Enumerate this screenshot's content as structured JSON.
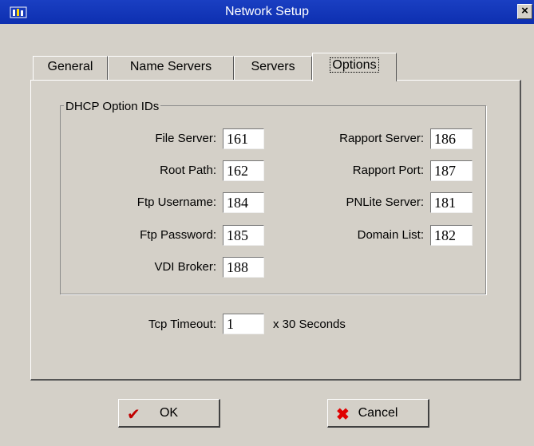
{
  "window": {
    "title": "Network Setup",
    "close_glyph": "×"
  },
  "tabs": [
    {
      "label": "General"
    },
    {
      "label": "Name Servers"
    },
    {
      "label": "Servers"
    },
    {
      "label": "Options",
      "active": true
    }
  ],
  "group": {
    "label": "DHCP Option IDs"
  },
  "left_fields": [
    {
      "label": "File Server:",
      "value": "161"
    },
    {
      "label": "Root Path:",
      "value": "162"
    },
    {
      "label": "Ftp Username:",
      "value": "184"
    },
    {
      "label": "Ftp Password:",
      "value": "185"
    },
    {
      "label": "VDI Broker:",
      "value": "188"
    }
  ],
  "right_fields": [
    {
      "label": "Rapport Server:",
      "value": "186"
    },
    {
      "label": "Rapport Port:",
      "value": "187"
    },
    {
      "label": "PNLite Server:",
      "value": "181"
    },
    {
      "label": "Domain List:",
      "value": "182"
    }
  ],
  "timeout": {
    "label": "Tcp Timeout:",
    "value": "1",
    "suffix": "x  30 Seconds"
  },
  "buttons": {
    "ok": "OK",
    "cancel": "Cancel"
  },
  "colors": {
    "titlebar": "#0d2fb0",
    "ok_icon": "#c00000",
    "cancel_icon": "#e00000"
  },
  "icons": {
    "app": "network-app-icon",
    "ok": "checkmark-icon",
    "cancel": "x-mark-icon"
  }
}
